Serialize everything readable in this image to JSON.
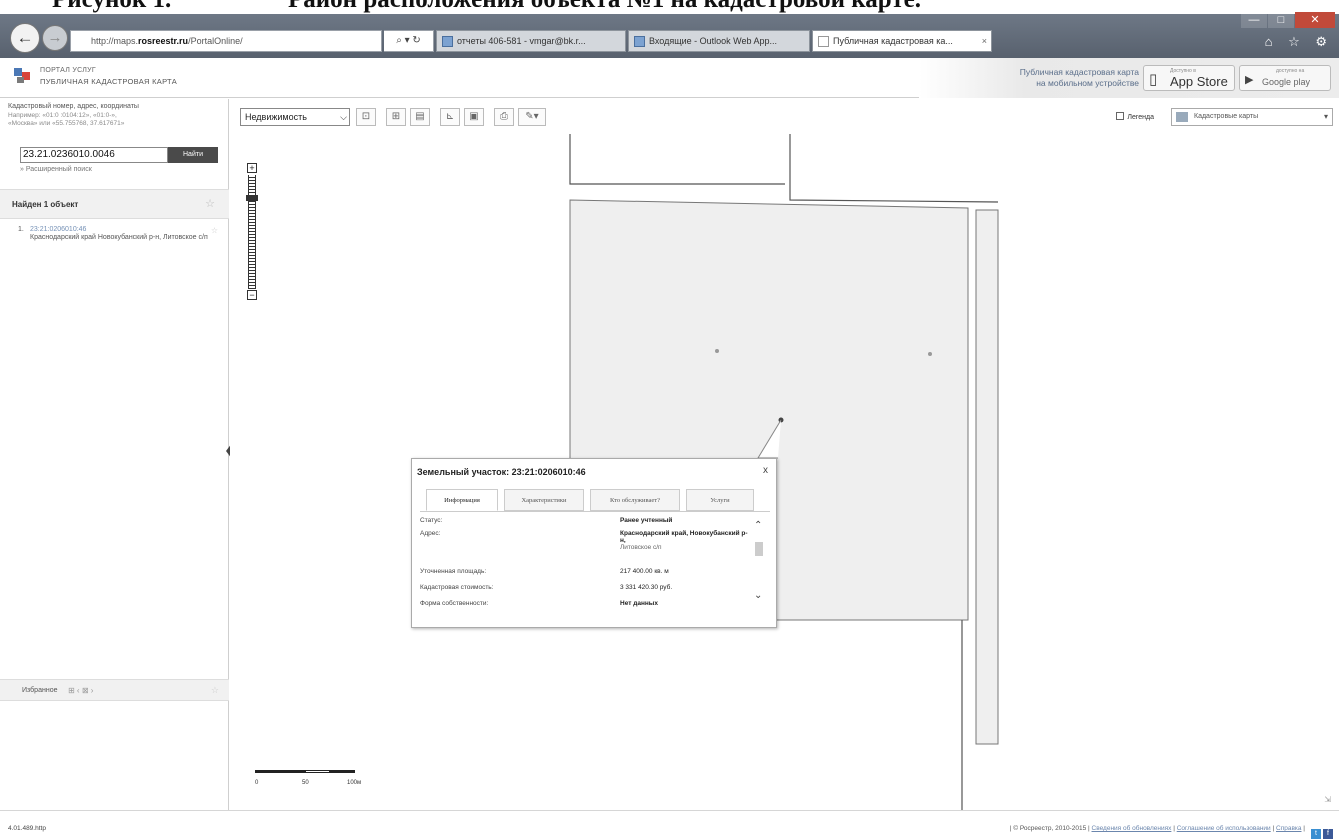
{
  "document": {
    "caption_num": "Рисунок 1.",
    "caption_text": "Район расположения объекта №1 на кадастровой карте."
  },
  "browser": {
    "url_prefix": "http://maps.",
    "url_domain": "rosreestr.ru",
    "url_suffix": "/PortalOnline/",
    "address_icons": "⌕ ▾ ↻",
    "tabs": [
      {
        "label": "отчеты 406-581 - vmgar@bk.r..."
      },
      {
        "label": "Входящие - Outlook Web App..."
      },
      {
        "label": "Публичная кадастровая ка..."
      }
    ],
    "window_controls": [
      "—",
      "□",
      "✕"
    ],
    "toolbar_icons": "⌂ ☆ ⚙"
  },
  "portal": {
    "title_line1": "ПОРТАЛ УСЛУГ",
    "title_line2": "ПУБЛИЧНАЯ КАДАСТРОВАЯ КАРТА",
    "mobile_text_line1": "Публичная кадастровая карта",
    "mobile_text_line2": "на мобильном устройстве",
    "appstore_small": "Доступно в",
    "appstore_label": "App Store",
    "googleplay_small": "доступно на",
    "googleplay_label": "Google play"
  },
  "search": {
    "hint_line1": "Кадастровый номер, адрес, координаты",
    "hint_line2": "Например: «01:0 :0104:12», «01:0-»,",
    "hint_line3": "«Москва» или «55.755768, 37.617671»",
    "input_value": "23.21.0236010.0046",
    "button_label": "Найти",
    "advanced_link": "» Расширенный поиск"
  },
  "results": {
    "found_label": "Найден 1 объект",
    "items": [
      {
        "num": "1.",
        "id": "23:21:0206010:46",
        "address": "Краснодарский край Новокубанский р-н, Литовское с/п"
      }
    ]
  },
  "favorites": {
    "label": "Избранное",
    "icons": "⊞ ‹ ⊠ ›"
  },
  "toolbar": {
    "layer_select": "Недвижимость",
    "legend_label": "Легенда",
    "basemap_label": "Кадастровые карты",
    "dropdown_glyph": "▾"
  },
  "zoom": {
    "plus": "+",
    "minus": "−"
  },
  "scale": {
    "labels": [
      "0",
      "50",
      "100м"
    ]
  },
  "popup": {
    "title": "Земельный участок: 23:21:0206010:46",
    "close": "x",
    "tabs": [
      "Информация",
      "Характеристики",
      "Кто обслуживает?",
      "Услуги"
    ],
    "rows": [
      {
        "key": "Статус:",
        "value": "Ранее учтенный"
      },
      {
        "key": "Адрес:",
        "value": "Краснодарский край, Новокубанский р-н,",
        "sub": "Литовское с/п"
      },
      {
        "key": "Уточненная площадь:",
        "value": "217 400.00 кв. м"
      },
      {
        "key": "Кадастровая стоимость:",
        "value": "3 331 420.30 руб."
      },
      {
        "key": "Форма собственности:",
        "value": "Нет данных"
      }
    ],
    "scroll_up": "⌃",
    "scroll_down": "⌄"
  },
  "status": {
    "version": "4.01.489.http",
    "copyright": "| © Росреестр, 2010-2015 | ",
    "link1": "Сведения об обновлениях",
    "link2": "Соглашение об использовании",
    "link3": "Справка",
    "separator": " | ",
    "social_icons": [
      "t",
      "f"
    ],
    "resize_glyph": "⇲"
  },
  "colors": {
    "parcel_fill": "#efefef",
    "link_blue": "#6b86ad",
    "chrome_gray": "#5f6874"
  }
}
